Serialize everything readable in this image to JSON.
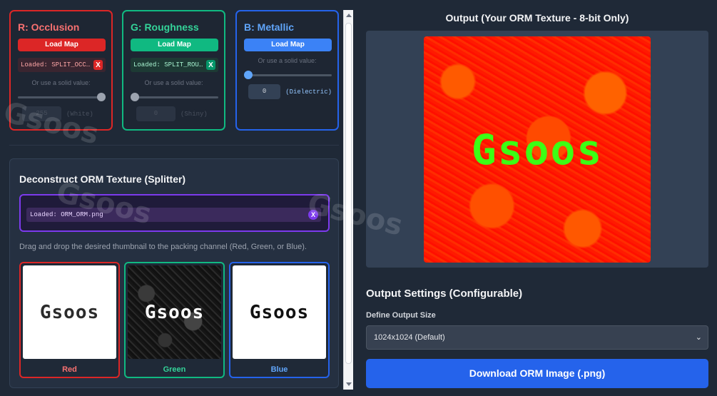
{
  "channels": {
    "r": {
      "title": "R: Occlusion",
      "load_label": "Load Map",
      "loaded_text": "Loaded: SPLIT_OCCLUSION.png",
      "remove_label": "X",
      "solid_label": "Or use a solid value:",
      "slider_value": 1.0,
      "value": "255",
      "value_note": "(White)"
    },
    "g": {
      "title": "G: Roughness",
      "load_label": "Load Map",
      "loaded_text": "Loaded: SPLIT_ROUGHNESS.png",
      "remove_label": "X",
      "solid_label": "Or use a solid value:",
      "slider_value": 0.0,
      "value": "0",
      "value_note": "(Shiny)"
    },
    "b": {
      "title": "B: Metallic",
      "load_label": "Load Map",
      "solid_label": "Or use a solid value:",
      "slider_value": 0.0,
      "value": "0",
      "value_note": "(Dielectric)"
    }
  },
  "splitter": {
    "title": "Deconstruct ORM Texture (Splitter)",
    "loaded_text": "Loaded: ORM_ORM.png",
    "remove_label": "X",
    "hint": "Drag and drop the desired thumbnail to the packing channel (Red, Green, or Blue).",
    "thumbnails": [
      {
        "label": "Red",
        "image_text": "Gsoos"
      },
      {
        "label": "Green",
        "image_text": "Gsoos"
      },
      {
        "label": "Blue",
        "image_text": "Gsoos"
      }
    ]
  },
  "output": {
    "title": "Output (Your ORM Texture - 8-bit Only)",
    "image_text": "Gsoos",
    "settings_title": "Output Settings (Configurable)",
    "size_label": "Define Output Size",
    "size_value": "1024x1024 (Default)",
    "download_label": "Download ORM Image (.png)"
  },
  "watermark": "Gsoos",
  "colors": {
    "red": "#dc2626",
    "green": "#10b981",
    "blue": "#2563eb",
    "purple": "#7c3aed",
    "background": "#1f2937"
  }
}
